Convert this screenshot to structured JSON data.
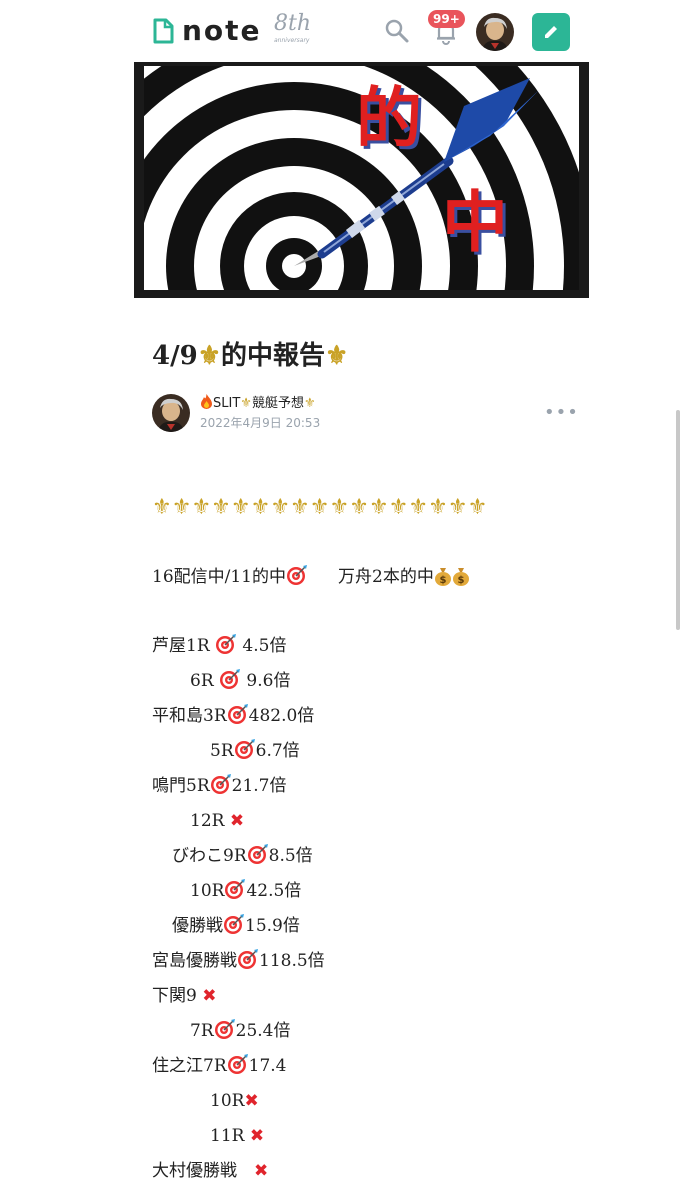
{
  "header": {
    "logo_text": "note",
    "anniversary_number": "8th",
    "anniversary_label": "anniversary",
    "notification_count": "99+",
    "icons": {
      "logo": "note-logo-icon",
      "search": "search-icon",
      "notifications": "bell-icon",
      "avatar": "user-avatar",
      "write": "pencil-icon"
    },
    "accent_color": "#2cb696",
    "badge_color": "#e9545b"
  },
  "article": {
    "title_prefix": "4/9",
    "title_main": "的中報告",
    "author_prefix": "SLIT",
    "author_suffix": "競艇予想",
    "date": "2022年4月9日 20:53",
    "more_label": "•••"
  },
  "body": {
    "summary_a": "16配信中/11的中",
    "summary_b": "万舟2本的中",
    "results": [
      {
        "label": "芦屋1R ",
        "value": " 4.5倍",
        "mark": "hit"
      },
      {
        "label": "6R ",
        "value": " 9.6倍",
        "mark": "hit"
      },
      {
        "label": "平和島3R",
        "value": "482.0倍",
        "mark": "hit"
      },
      {
        "label": "5R",
        "value": "6.7倍",
        "mark": "hit"
      },
      {
        "label": "鳴門5R",
        "value": "21.7倍",
        "mark": "hit"
      },
      {
        "label": "12R ",
        "value": "",
        "mark": "miss"
      },
      {
        "label": "びわこ9R",
        "value": "8.5倍",
        "mark": "hit"
      },
      {
        "label": "10R",
        "value": "42.5倍",
        "mark": "hit"
      },
      {
        "label": "優勝戦",
        "value": "15.9倍",
        "mark": "hit"
      },
      {
        "label": "宮島優勝戦",
        "value": "118.5倍",
        "mark": "hit"
      },
      {
        "label": "下関9 ",
        "value": "",
        "mark": "miss"
      },
      {
        "label": "7R",
        "value": "25.4倍",
        "mark": "hit"
      },
      {
        "label": "住之江7R",
        "value": "17.4",
        "mark": "hit"
      },
      {
        "label": "10R",
        "value": "",
        "mark": "miss"
      },
      {
        "label": "11R ",
        "value": "",
        "mark": "miss"
      },
      {
        "label": "大村優勝戦　",
        "value": "",
        "mark": "miss"
      }
    ]
  },
  "hero": {
    "kanji_top": "的",
    "kanji_bottom": "中"
  }
}
